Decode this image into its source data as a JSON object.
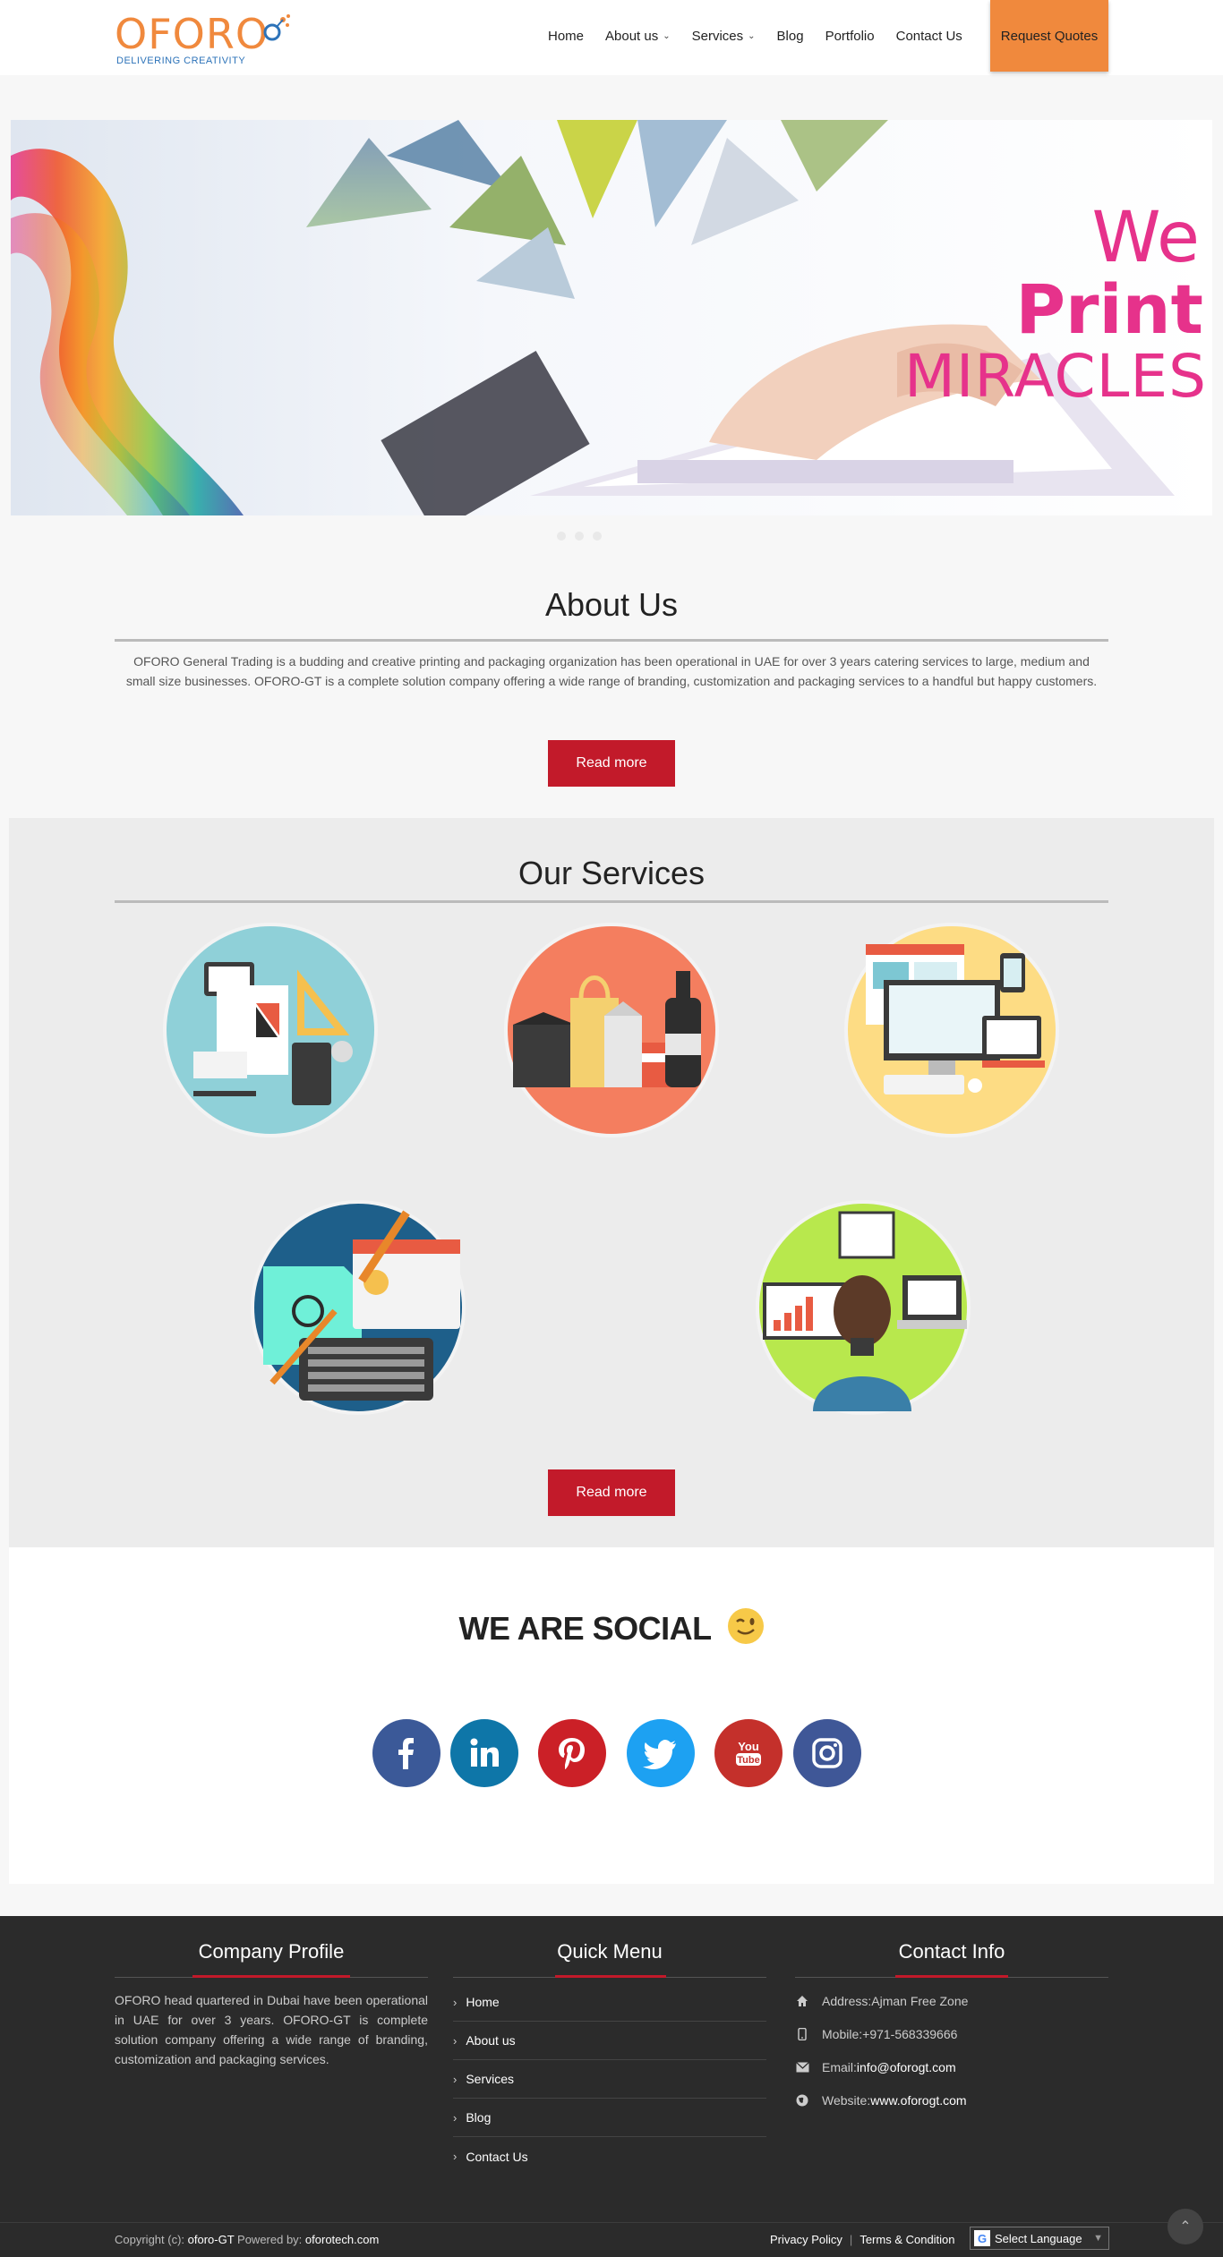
{
  "header": {
    "logo_text": "OFORO",
    "logo_tagline": "DELIVERING CREATIVITY",
    "nav": [
      {
        "label": "Home",
        "dropdown": false
      },
      {
        "label": "About us",
        "dropdown": true
      },
      {
        "label": "Services",
        "dropdown": true
      },
      {
        "label": "Blog",
        "dropdown": false
      },
      {
        "label": "Portfolio",
        "dropdown": false
      },
      {
        "label": "Contact Us",
        "dropdown": false
      }
    ],
    "quote_button": "Request Quotes",
    "colors": {
      "brand_orange": "#f0893d",
      "brand_blue": "#2d73b9"
    }
  },
  "hero": {
    "line1": "We",
    "line2": "Print",
    "line3": "MIRACLES",
    "accent": "#e6328b"
  },
  "about": {
    "title": "About Us",
    "text": "OFORO General Trading is a budding and creative printing and packaging organization has been operational in UAE for over 3 years catering services to large, medium and small size businesses. OFORO-GT is a complete solution company offering a wide range of branding, customization and packaging services to a handful but happy customers.",
    "button": "Read more"
  },
  "services": {
    "title": "Our Services",
    "items": [
      {
        "icon": "stationery-design-icon"
      },
      {
        "icon": "packaging-icon"
      },
      {
        "icon": "web-devices-icon"
      },
      {
        "icon": "graphic-design-icon"
      },
      {
        "icon": "digital-marketing-icon"
      }
    ],
    "button": "Read more"
  },
  "social": {
    "title": "WE ARE SOCIAL",
    "networks": [
      {
        "name": "facebook-icon",
        "color": "#3b5998"
      },
      {
        "name": "linkedin-icon",
        "color": "#0e76a8"
      },
      {
        "name": "pinterest-icon",
        "color": "#cb2027"
      },
      {
        "name": "twitter-icon",
        "color": "#1da1f2"
      },
      {
        "name": "youtube-icon",
        "color": "#c4302b"
      },
      {
        "name": "instagram-icon",
        "color": "#3f5797"
      }
    ]
  },
  "footer": {
    "company": {
      "title": "Company Profile",
      "text": "OFORO head quartered in Dubai have been operational in UAE for over 3 years. OFORO-GT is complete solution company offering a wide range of branding, customization and packaging services."
    },
    "quick_menu": {
      "title": "Quick Menu",
      "items": [
        "Home",
        "About us",
        "Services",
        "Blog",
        "Contact Us"
      ]
    },
    "contact": {
      "title": "Contact Info",
      "address_label": "Address: ",
      "address": "Ajman Free Zone",
      "mobile_label": "Mobile: ",
      "mobile": "+971-568339666",
      "email_label": "Email: ",
      "email": "info@oforogt.com",
      "website_label": "Website: ",
      "website": "www.oforogt.com"
    },
    "copyright_prefix": "Copyright (c): ",
    "copyright_owner": "oforo-GT",
    "powered_prefix": " Powered by: ",
    "powered_by": "oforotech.com",
    "privacy": "Privacy Policy",
    "separator": "|",
    "terms": "Terms & Condition",
    "language": "Select Language"
  }
}
